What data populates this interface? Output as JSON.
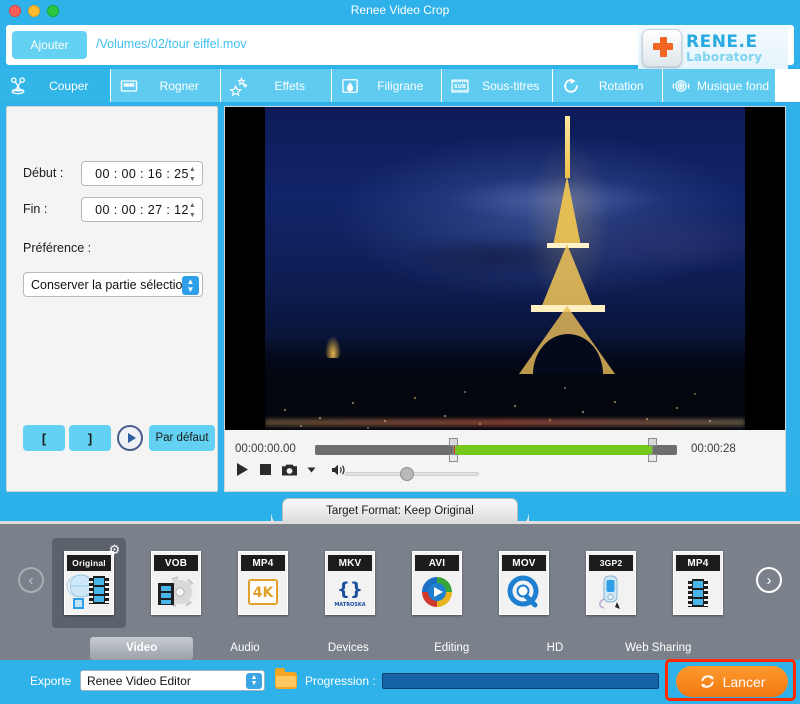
{
  "window": {
    "title": "Renee Video Crop",
    "controls": [
      "close",
      "minimize",
      "maximize"
    ]
  },
  "header": {
    "add_button": "Ajouter",
    "file_path": "/Volumes/02/tour eiffel.mov",
    "logo_main": "RENE.E",
    "logo_sub": "Laboratory"
  },
  "top_tabs": [
    {
      "label": "Couper",
      "icon": "scissors-icon",
      "active": true
    },
    {
      "label": "Rogner",
      "icon": "crop-icon",
      "active": false
    },
    {
      "label": "Effets",
      "icon": "sparkle-icon",
      "active": false
    },
    {
      "label": "Filigrane",
      "icon": "watermark-icon",
      "active": false
    },
    {
      "label": "Sous-titres",
      "icon": "subtitle-icon",
      "active": false
    },
    {
      "label": "Rotation",
      "icon": "rotate-icon",
      "active": false
    },
    {
      "label": "Musique fond",
      "icon": "audio-disc-icon",
      "active": false
    }
  ],
  "left_panel": {
    "start_label": "Début :",
    "start_value": "00 : 00  : 16  : 25",
    "end_label": "Fin :",
    "end_value": "00 : 00  : 27  : 12",
    "preference_label": "Préférence :",
    "preference_value": "Conserver la partie sélection...",
    "mark_in": "[",
    "mark_out": "]",
    "preview_icon": "play-circle-icon",
    "default_button": "Par défaut"
  },
  "player": {
    "preview_alt": "eiffel-tower-night-video-frame",
    "time_current": "00:00:00.00",
    "time_total": "00:00:28",
    "selection_start_pct": 38,
    "selection_end_pct": 93,
    "volume_pct": 46,
    "controls": [
      {
        "name": "play-icon"
      },
      {
        "name": "stop-icon"
      },
      {
        "name": "snapshot-camera-icon"
      },
      {
        "name": "snapshot-dropdown-icon"
      },
      {
        "name": "volume-icon"
      }
    ]
  },
  "format_section": {
    "tab_label": "Target Format: Keep Original",
    "prev_arrow": "‹",
    "next_arrow": "›",
    "items": [
      {
        "label": "Original",
        "art": "original-globe-film-icon",
        "selected": true,
        "badge": "gear-icon"
      },
      {
        "label": "VOB",
        "art": "disc-film-icon",
        "selected": false,
        "badge": ""
      },
      {
        "label": "MP4",
        "art": "4k-icon",
        "selected": false,
        "badge": ""
      },
      {
        "label": "MKV",
        "art": "matroska-icon",
        "selected": false,
        "badge": ""
      },
      {
        "label": "AVI",
        "art": "color-wheel-play-icon",
        "selected": false,
        "badge": ""
      },
      {
        "label": "MOV",
        "art": "quicktime-q-icon",
        "selected": false,
        "badge": ""
      },
      {
        "label": "3GP2",
        "art": "mobile-phone-icon",
        "selected": false,
        "badge": ""
      },
      {
        "label": "MP4",
        "art": "film-strip-icon",
        "selected": false,
        "badge": ""
      }
    ]
  },
  "category_tabs": [
    {
      "label": "Video",
      "active": true
    },
    {
      "label": "Audio",
      "active": false
    },
    {
      "label": "Devices",
      "active": false
    },
    {
      "label": "Editing",
      "active": false
    },
    {
      "label": "HD",
      "active": false
    },
    {
      "label": "Web Sharing",
      "active": false
    }
  ],
  "export_bar": {
    "export_label": "Exporte",
    "export_value": "Renee Video Editor",
    "folder_icon": "folder-icon",
    "progress_label": "Progression :",
    "progress_pct": 0,
    "launch_label": "Lancer",
    "launch_icon": "refresh-circle-icon"
  },
  "colors": {
    "brand_blue": "#2eb2e9",
    "tab_blue": "#5fcbf0",
    "accent_cyan": "#63d2f2",
    "panel_grey": "#7b818a",
    "selection_green": "#76c91a",
    "launch_orange": "#f07a12",
    "highlight_red": "#ff2a00"
  }
}
